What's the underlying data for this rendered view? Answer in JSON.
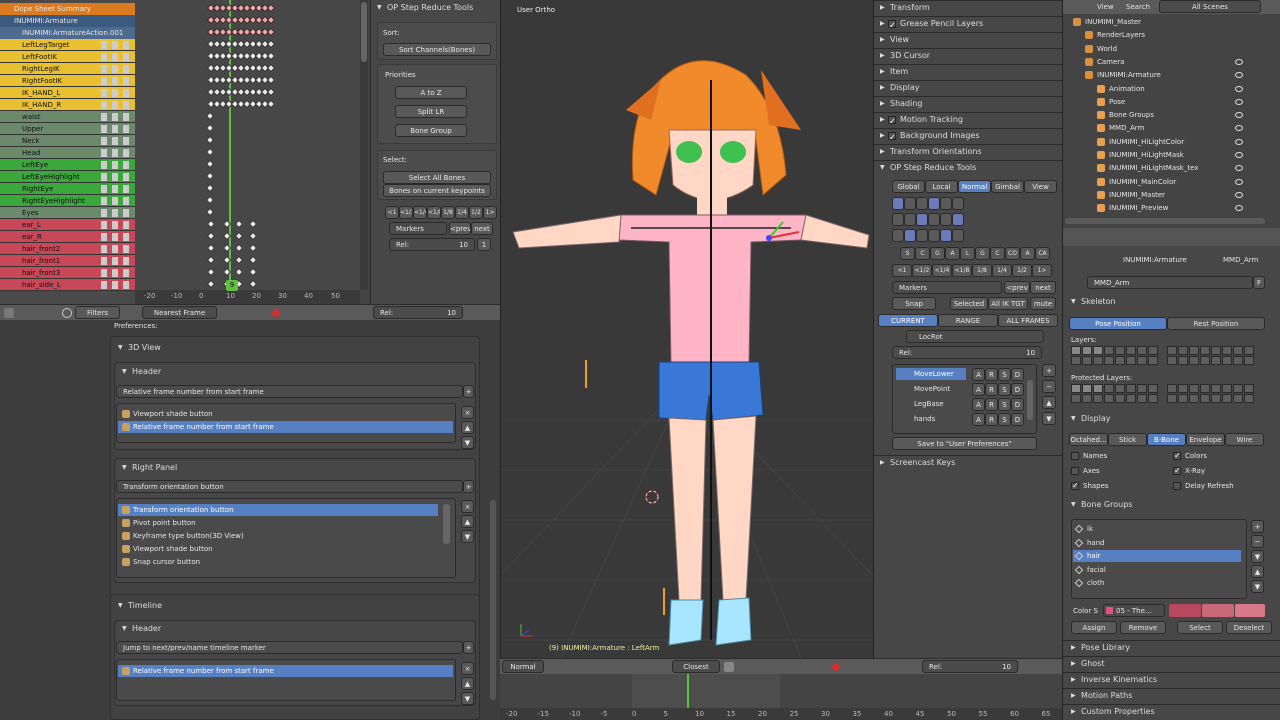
{
  "dopesheet": {
    "summary": "Dope Sheet Summary",
    "object": "INUMIMI:Armature",
    "action": "INUMIMI:ArmatureAction.001",
    "channels": [
      {
        "name": "LeftLegTarget",
        "c": "#e8c030"
      },
      {
        "name": "LeftFootIK",
        "c": "#e8c030"
      },
      {
        "name": "RightLegIK",
        "c": "#e8c030"
      },
      {
        "name": "RightFootIK",
        "c": "#e8c030"
      },
      {
        "name": "IK_HAND_L",
        "c": "#e8c030"
      },
      {
        "name": "IK_HAND_R",
        "c": "#e8c030"
      },
      {
        "name": "waist",
        "c": "#6b8a6b"
      },
      {
        "name": "Upper",
        "c": "#6b8a6b"
      },
      {
        "name": "Neck",
        "c": "#6b8a6b"
      },
      {
        "name": "Head",
        "c": "#6b8a6b"
      },
      {
        "name": "LeftEye",
        "c": "#3aa83a"
      },
      {
        "name": "LeftEyeHighlight",
        "c": "#3aa83a"
      },
      {
        "name": "RightEye",
        "c": "#3aa83a"
      },
      {
        "name": "RightEyeHighlight",
        "c": "#3aa83a"
      },
      {
        "name": "Eyes",
        "c": "#6b8a6b"
      },
      {
        "name": "ear_L",
        "c": "#c84858"
      },
      {
        "name": "ear_R",
        "c": "#c84858"
      },
      {
        "name": "hair_front2",
        "c": "#c84858"
      },
      {
        "name": "hair_front1",
        "c": "#c84858"
      },
      {
        "name": "hair_front3",
        "c": "#c84858"
      },
      {
        "name": "hair_side_L",
        "c": "#c84858"
      }
    ],
    "ruler": [
      "-20",
      "-10",
      "0",
      "10",
      "20",
      "30",
      "40",
      "50"
    ],
    "current_frame": "9",
    "footer": {
      "filters": "Filters",
      "interp": "Nearest Frame",
      "rel": "Rel:",
      "rel_val": "10"
    }
  },
  "op_tools": {
    "title": "OP Step Reduce Tools",
    "sort": "Sort:",
    "sort_btn": "Sort Channels(Bones)",
    "priorities": "Priorities",
    "p1": "A to Z",
    "p2": "Split LR",
    "p3": "Bone Group",
    "select": "Select:",
    "sel1": "Select All Bones",
    "sel2": "Bones on current keypoints",
    "steps": [
      "<1",
      "<1/2",
      "<1/4",
      "<1/8",
      "1/8",
      "1/4",
      "1/2",
      "1>"
    ],
    "markers": "Markers",
    "prev": "<prev",
    "next": "next",
    "rel": "Rel:",
    "rel_val": "10",
    "one": "1"
  },
  "prefs": {
    "title": "Preferences:",
    "sec1": "3D View",
    "sub1": "Header",
    "dd1": "Relative frame number from start frame",
    "list1": [
      "Viewport shade button",
      "Relative frame number from start frame"
    ],
    "sub2": "Right Panel",
    "dd2": "Transform orientation button",
    "list2": [
      "Transform orientation button",
      "Pivot point button",
      "Keyframe type button(3D View)",
      "Viewport shade button",
      "Snap cursor button"
    ],
    "sec2": "Timeline",
    "sub3": "Header",
    "dd3": "Jump to next/prev/name timeline marker",
    "list3": [
      "Relative frame number from start frame"
    ]
  },
  "viewport": {
    "label": "User Ortho",
    "status": "(9) INUMIMI:Armature : LeftArm",
    "mode": "Normal",
    "snap": "Closest",
    "rel": "Rel:",
    "rel_val": "10",
    "ruler": [
      "-20",
      "-15",
      "-10",
      "-5",
      "0",
      "5",
      "10",
      "15",
      "20",
      "25",
      "30",
      "35",
      "40",
      "45",
      "50",
      "55",
      "60",
      "65"
    ]
  },
  "npanel": {
    "items": [
      {
        "t": "Transform",
        "c": true
      },
      {
        "t": "Grease Pencil Layers",
        "c": true,
        "chk": true
      },
      {
        "t": "View",
        "c": true
      },
      {
        "t": "3D Cursor",
        "c": true
      },
      {
        "t": "Item",
        "c": true
      },
      {
        "t": "Display",
        "c": true
      },
      {
        "t": "Shading",
        "c": true
      },
      {
        "t": "Motion Tracking",
        "c": true,
        "chk": true
      },
      {
        "t": "Background Images",
        "c": true,
        "chk": true
      },
      {
        "t": "Transform Orientations",
        "c": true
      },
      {
        "t": "OP Step Reduce Tools",
        "c": false
      }
    ],
    "orient": [
      "Global",
      "Local",
      "Normal",
      "Gimbal",
      "View"
    ],
    "kf": [
      "S",
      "C",
      "G",
      "A",
      "L",
      "G",
      "C",
      "CO",
      "A",
      "CA"
    ],
    "steps": [
      "<1",
      "<1/2",
      "<1/4",
      "<1/8",
      "1/8",
      "1/4",
      "1/2",
      "1>"
    ],
    "markers": "Markers",
    "prev": "<prev",
    "next": "next",
    "snap": "Snap",
    "selected": "Selected",
    "allik": "All IK TGT",
    "mute": "mute",
    "tabs": [
      "CURRENT",
      "RANGE",
      "ALL FRAMES"
    ],
    "locrot": "LocRot",
    "rel": "Rel:",
    "rel_val": "10",
    "bones": [
      "MoveLower",
      "MovePoint",
      "LegBase",
      "hands"
    ],
    "arsd": [
      "A",
      "R",
      "S",
      "D"
    ],
    "save": "Save to \"User Preferences\"",
    "screencast": "Screencast Keys"
  },
  "outliner": {
    "menu": [
      "View",
      "Search"
    ],
    "scene": "All Scenes",
    "tree": [
      {
        "t": "INUMIMI_Master",
        "d": 0
      },
      {
        "t": "RenderLayers",
        "d": 1
      },
      {
        "t": "World",
        "d": 1
      },
      {
        "t": "Camera",
        "d": 1
      },
      {
        "t": "INUMIMI:Armature",
        "d": 1
      },
      {
        "t": "Animation",
        "d": 2
      },
      {
        "t": "Pose",
        "d": 2
      },
      {
        "t": "Bone Groups",
        "d": 2
      },
      {
        "t": "MMD_Arm",
        "d": 2
      },
      {
        "t": "INUMIMI_HiLightColor",
        "d": 2
      },
      {
        "t": "INUMIMI_HiLightMask",
        "d": 2
      },
      {
        "t": "INUMIMI_HiLightMask_tex",
        "d": 2
      },
      {
        "t": "INUMIMI_MainColor",
        "d": 2
      },
      {
        "t": "INUMIMI_Master",
        "d": 2
      },
      {
        "t": "INUMIMI_Preview",
        "d": 2
      }
    ]
  },
  "props": {
    "path1": "INUMIMI:Armature",
    "path2": "MMD_Arm",
    "name": "MMD_Arm",
    "f": "F",
    "skeleton": "Skeleton",
    "pose": "Pose Position",
    "rest": "Rest Position",
    "layers": "Layers:",
    "prot": "Protected Layers:",
    "display": "Display",
    "disp_tabs": [
      "Octahed...",
      "Stick",
      "B-Bone",
      "Envelope",
      "Wire"
    ],
    "opts": [
      {
        "t": "Names",
        "on": false
      },
      {
        "t": "Colors",
        "on": true
      },
      {
        "t": "Axes",
        "on": false
      },
      {
        "t": "X-Ray",
        "on": true
      },
      {
        "t": "Shapes",
        "on": true
      },
      {
        "t": "Delay Refresh",
        "on": false
      }
    ],
    "bonegroups": "Bone Groups",
    "groups": [
      "ik",
      "hand",
      "hair",
      "facial",
      "cloth"
    ],
    "colorset": "Color S",
    "theme": "05 - The...",
    "actions": [
      "Assign",
      "Remove",
      "Select",
      "Deselect"
    ],
    "closed": [
      "Pose Library",
      "Ghost",
      "Inverse Kinematics",
      "Motion Paths",
      "Custom Properties"
    ]
  }
}
